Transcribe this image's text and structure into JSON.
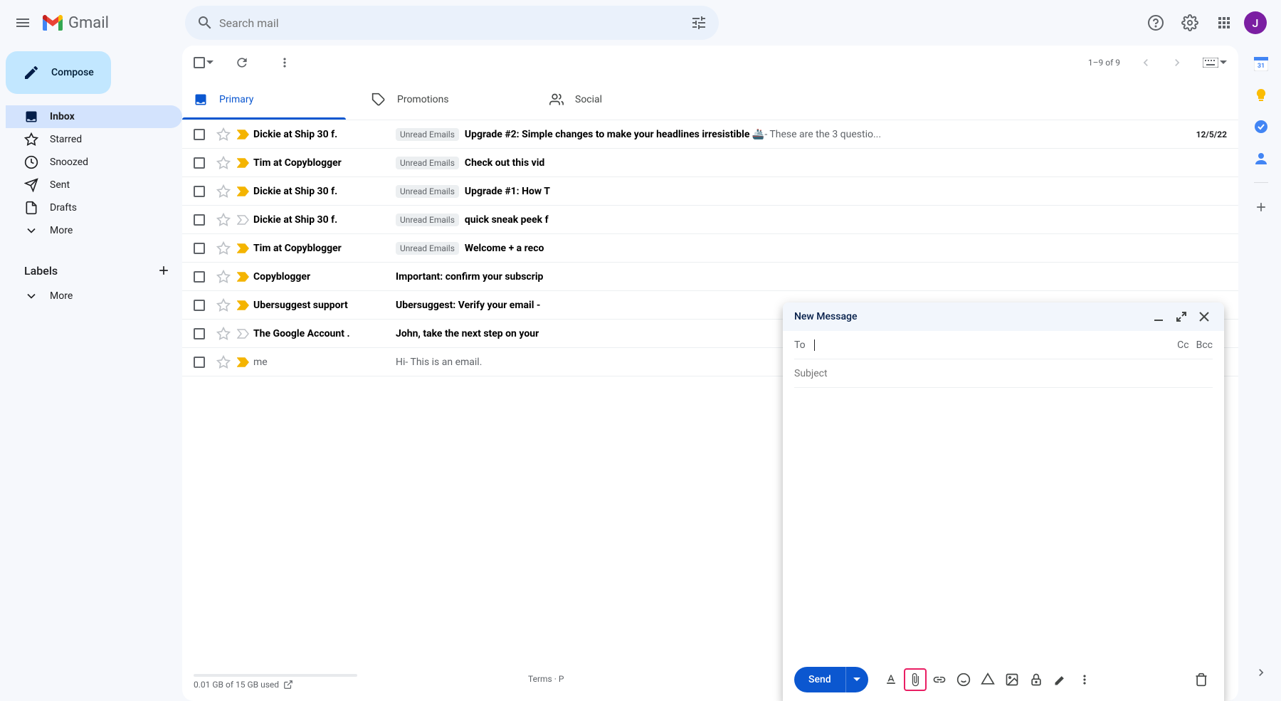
{
  "header": {
    "app_name": "Gmail",
    "search_placeholder": "Search mail",
    "avatar_letter": "J"
  },
  "sidebar": {
    "compose_label": "Compose",
    "items": [
      {
        "label": "Inbox",
        "icon": "inbox"
      },
      {
        "label": "Starred",
        "icon": "star"
      },
      {
        "label": "Snoozed",
        "icon": "clock"
      },
      {
        "label": "Sent",
        "icon": "send"
      },
      {
        "label": "Drafts",
        "icon": "draft"
      },
      {
        "label": "More",
        "icon": "expand"
      }
    ],
    "labels_title": "Labels",
    "more_label": "More"
  },
  "toolbar": {
    "page_info": "1–9 of 9"
  },
  "tabs": [
    {
      "label": "Primary"
    },
    {
      "label": "Promotions"
    },
    {
      "label": "Social"
    }
  ],
  "emails": [
    {
      "sender": "Dickie at Ship 30 f.",
      "label": "Unread Emails",
      "subject": "Upgrade #2: Simple changes to make your headlines irresistible 🚢",
      "snippet": " - These are the 3 questio...",
      "date": "12/5/22",
      "important": true,
      "read": false
    },
    {
      "sender": "Tim at Copyblogger",
      "label": "Unread Emails",
      "subject": "Check out this vid",
      "snippet": "",
      "date": "",
      "important": true,
      "read": false
    },
    {
      "sender": "Dickie at Ship 30 f.",
      "label": "Unread Emails",
      "subject": "Upgrade #1: How T",
      "snippet": "",
      "date": "",
      "important": true,
      "read": false
    },
    {
      "sender": "Dickie at Ship 30 f.",
      "label": "Unread Emails",
      "subject": "quick sneak peek f",
      "snippet": "",
      "date": "",
      "important": false,
      "read": false
    },
    {
      "sender": "Tim at Copyblogger",
      "label": "Unread Emails",
      "subject": "Welcome + a reco",
      "snippet": "",
      "date": "",
      "important": true,
      "read": false
    },
    {
      "sender": "Copyblogger",
      "label": "",
      "subject": "Important: confirm your subscrip",
      "snippet": "",
      "date": "",
      "important": true,
      "read": false
    },
    {
      "sender": "Ubersuggest support",
      "label": "",
      "subject": "Ubersuggest: Verify your email - ",
      "snippet": "",
      "date": "",
      "important": true,
      "read": false
    },
    {
      "sender": "The Google Account .",
      "label": "",
      "subject": "John, take the next step on your",
      "snippet": "",
      "date": "",
      "important": false,
      "read": false
    },
    {
      "sender": "me",
      "label": "",
      "subject": "Hi",
      "snippet": " - This is an email.",
      "date": "",
      "important": true,
      "read": true
    }
  ],
  "footer": {
    "storage": "0.01 GB of 15 GB used",
    "terms": "Terms · P"
  },
  "compose": {
    "title": "New Message",
    "to_label": "To",
    "cc_label": "Cc",
    "bcc_label": "Bcc",
    "subject_placeholder": "Subject",
    "send_label": "Send"
  },
  "side_calendar_day": "31"
}
